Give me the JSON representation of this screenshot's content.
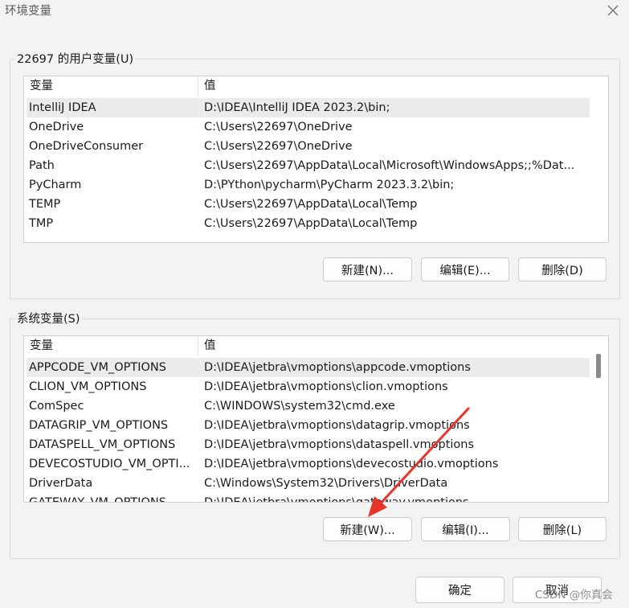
{
  "window": {
    "title": "环境变量"
  },
  "user_vars": {
    "label": "22697 的用户变量(U)",
    "col_name": "变量",
    "col_value": "值",
    "rows": [
      {
        "name": "IntelliJ IDEA",
        "value": "D:\\IDEA\\IntelliJ IDEA 2023.2\\bin;"
      },
      {
        "name": "OneDrive",
        "value": "C:\\Users\\22697\\OneDrive"
      },
      {
        "name": "OneDriveConsumer",
        "value": "C:\\Users\\22697\\OneDrive"
      },
      {
        "name": "Path",
        "value": "C:\\Users\\22697\\AppData\\Local\\Microsoft\\WindowsApps;;%Dat..."
      },
      {
        "name": "PyCharm",
        "value": "D:\\PYthon\\pycharm\\PyCharm 2023.3.2\\bin;"
      },
      {
        "name": "TEMP",
        "value": "C:\\Users\\22697\\AppData\\Local\\Temp"
      },
      {
        "name": "TMP",
        "value": "C:\\Users\\22697\\AppData\\Local\\Temp"
      }
    ],
    "new_label": "新建(N)...",
    "edit_label": "编辑(E)...",
    "delete_label": "删除(D)"
  },
  "system_vars": {
    "label": "系统变量(S)",
    "col_name": "变量",
    "col_value": "值",
    "rows": [
      {
        "name": "APPCODE_VM_OPTIONS",
        "value": "D:\\IDEA\\jetbra\\vmoptions\\appcode.vmoptions"
      },
      {
        "name": "CLION_VM_OPTIONS",
        "value": "D:\\IDEA\\jetbra\\vmoptions\\clion.vmoptions"
      },
      {
        "name": "ComSpec",
        "value": "C:\\WINDOWS\\system32\\cmd.exe"
      },
      {
        "name": "DATAGRIP_VM_OPTIONS",
        "value": "D:\\IDEA\\jetbra\\vmoptions\\datagrip.vmoptions"
      },
      {
        "name": "DATASPELL_VM_OPTIONS",
        "value": "D:\\IDEA\\jetbra\\vmoptions\\dataspell.vmoptions"
      },
      {
        "name": "DEVECOSTUDIO_VM_OPTI...",
        "value": "D:\\IDEA\\jetbra\\vmoptions\\devecostudio.vmoptions"
      },
      {
        "name": "DriverData",
        "value": "C:\\Windows\\System32\\Drivers\\DriverData"
      },
      {
        "name": "GATEWAY_VM_OPTIONS",
        "value": "D:\\IDEA\\jetbra\\vmoptions\\gateway.vmoptions"
      }
    ],
    "new_label": "新建(W)...",
    "edit_label": "编辑(I)...",
    "delete_label": "删除(L)"
  },
  "footer": {
    "ok_label": "确定",
    "cancel_label": "取消"
  },
  "watermark": "CSDN @你真会",
  "colors": {
    "annotation_arrow": "#e8332a",
    "selected_row": "#ebebeb"
  },
  "icons": {
    "close": "close-icon",
    "annotation": "red-arrow"
  }
}
